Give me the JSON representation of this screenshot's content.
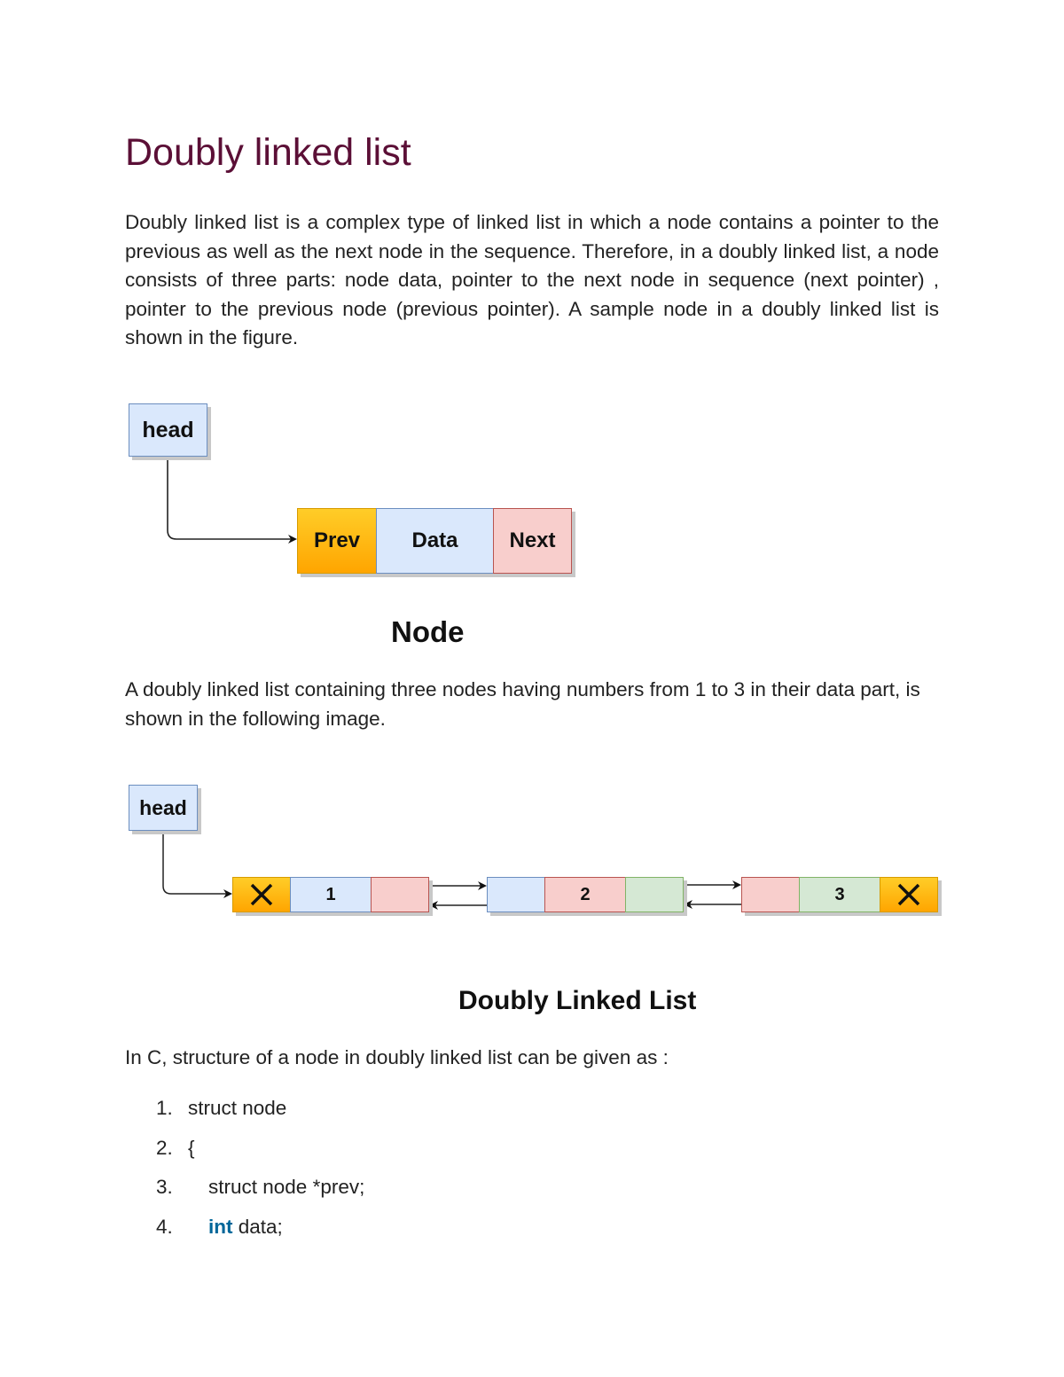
{
  "document": {
    "title": "Doubly linked list",
    "intro": "Doubly linked list is a complex type of linked list in which a node contains a pointer to the previous as well as the next node in the sequence. Therefore, in a doubly linked list, a node consists of three parts: node data, pointer to the next node in sequence (next pointer) , pointer to the previous node (previous pointer). A sample node in a doubly linked list is shown in the figure.",
    "figure1": {
      "head_label": "head",
      "cells": [
        "Prev",
        "Data",
        "Next"
      ],
      "caption": "Node"
    },
    "para2": "A doubly linked list containing three nodes having numbers from 1 to 3 in their data part, is shown in the following image.",
    "figure2": {
      "head_label": "head",
      "nodes": [
        {
          "prev": "null-x-icon",
          "data": "1",
          "next": ""
        },
        {
          "prev": "",
          "data": "2",
          "next": ""
        },
        {
          "prev": "",
          "data": "3",
          "next": "null-x-icon"
        }
      ],
      "caption": "Doubly Linked List"
    },
    "para3": "In C, structure of a node in doubly linked list can be given as :",
    "code": [
      {
        "num": "1.",
        "text": "struct node",
        "indent": false
      },
      {
        "num": "2.",
        "text": "{",
        "indent": false
      },
      {
        "num": "3.",
        "text": "struct node *prev;",
        "indent": true
      },
      {
        "num": "4.",
        "keyword": "int",
        "text": " data;",
        "indent": true
      }
    ]
  }
}
